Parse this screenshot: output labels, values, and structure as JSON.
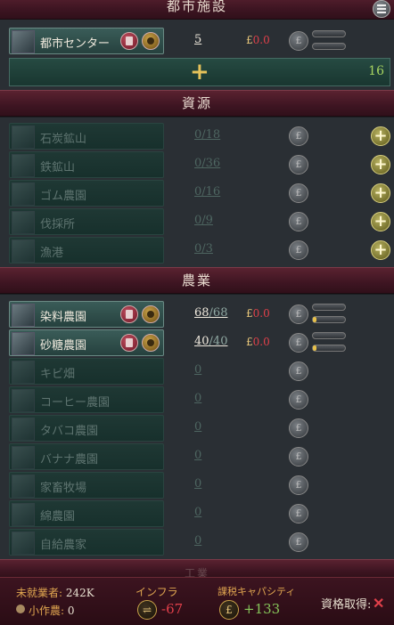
{
  "sections": {
    "urban": "都市施設",
    "resources": "資源",
    "agriculture": "農業",
    "next": "工業"
  },
  "urban": {
    "city_center": {
      "name": "都市センター",
      "level": "5",
      "cost_symbol": "£",
      "cost": "0.0"
    },
    "build": {
      "plus": "+",
      "count": "16"
    }
  },
  "resources": [
    {
      "name": "石炭鉱山",
      "level": "0",
      "max": "/18"
    },
    {
      "name": "鉄鉱山",
      "level": "0",
      "max": "/36"
    },
    {
      "name": "ゴム農園",
      "level": "0",
      "max": "/16"
    },
    {
      "name": "伐採所",
      "level": "0",
      "max": "/9"
    },
    {
      "name": "漁港",
      "level": "0",
      "max": "/3"
    }
  ],
  "agriculture": [
    {
      "name": "染料農園",
      "level": "68",
      "max": "/68",
      "cost_symbol": "£",
      "cost": "0.0",
      "fill": 0.1
    },
    {
      "name": "砂糖農園",
      "level": "40",
      "max": "/40",
      "cost_symbol": "£",
      "cost": "0.0",
      "fill": 0.1
    },
    {
      "name": "キビ畑",
      "level": "0"
    },
    {
      "name": "コーヒー農園",
      "level": "0"
    },
    {
      "name": "タバコ農園",
      "level": "0"
    },
    {
      "name": "バナナ農園",
      "level": "0"
    },
    {
      "name": "家畜牧場",
      "level": "0"
    },
    {
      "name": "綿農園",
      "level": "0"
    },
    {
      "name": "自給農家",
      "level": "0"
    }
  ],
  "footer": {
    "unemployed_label": "未就業者:",
    "unemployed_value": "242K",
    "peasants_label": "小作農:",
    "peasants_value": "0",
    "infra_label": "インフラ",
    "infra_value": "-67",
    "tax_label": "課税キャパシティ",
    "tax_value": "+133",
    "qualify_label": "資格取得:",
    "tax_icon": "£"
  },
  "colors": {
    "accent_gold": "#e6c57a",
    "negative": "#e0404a",
    "positive": "#86c65a"
  }
}
